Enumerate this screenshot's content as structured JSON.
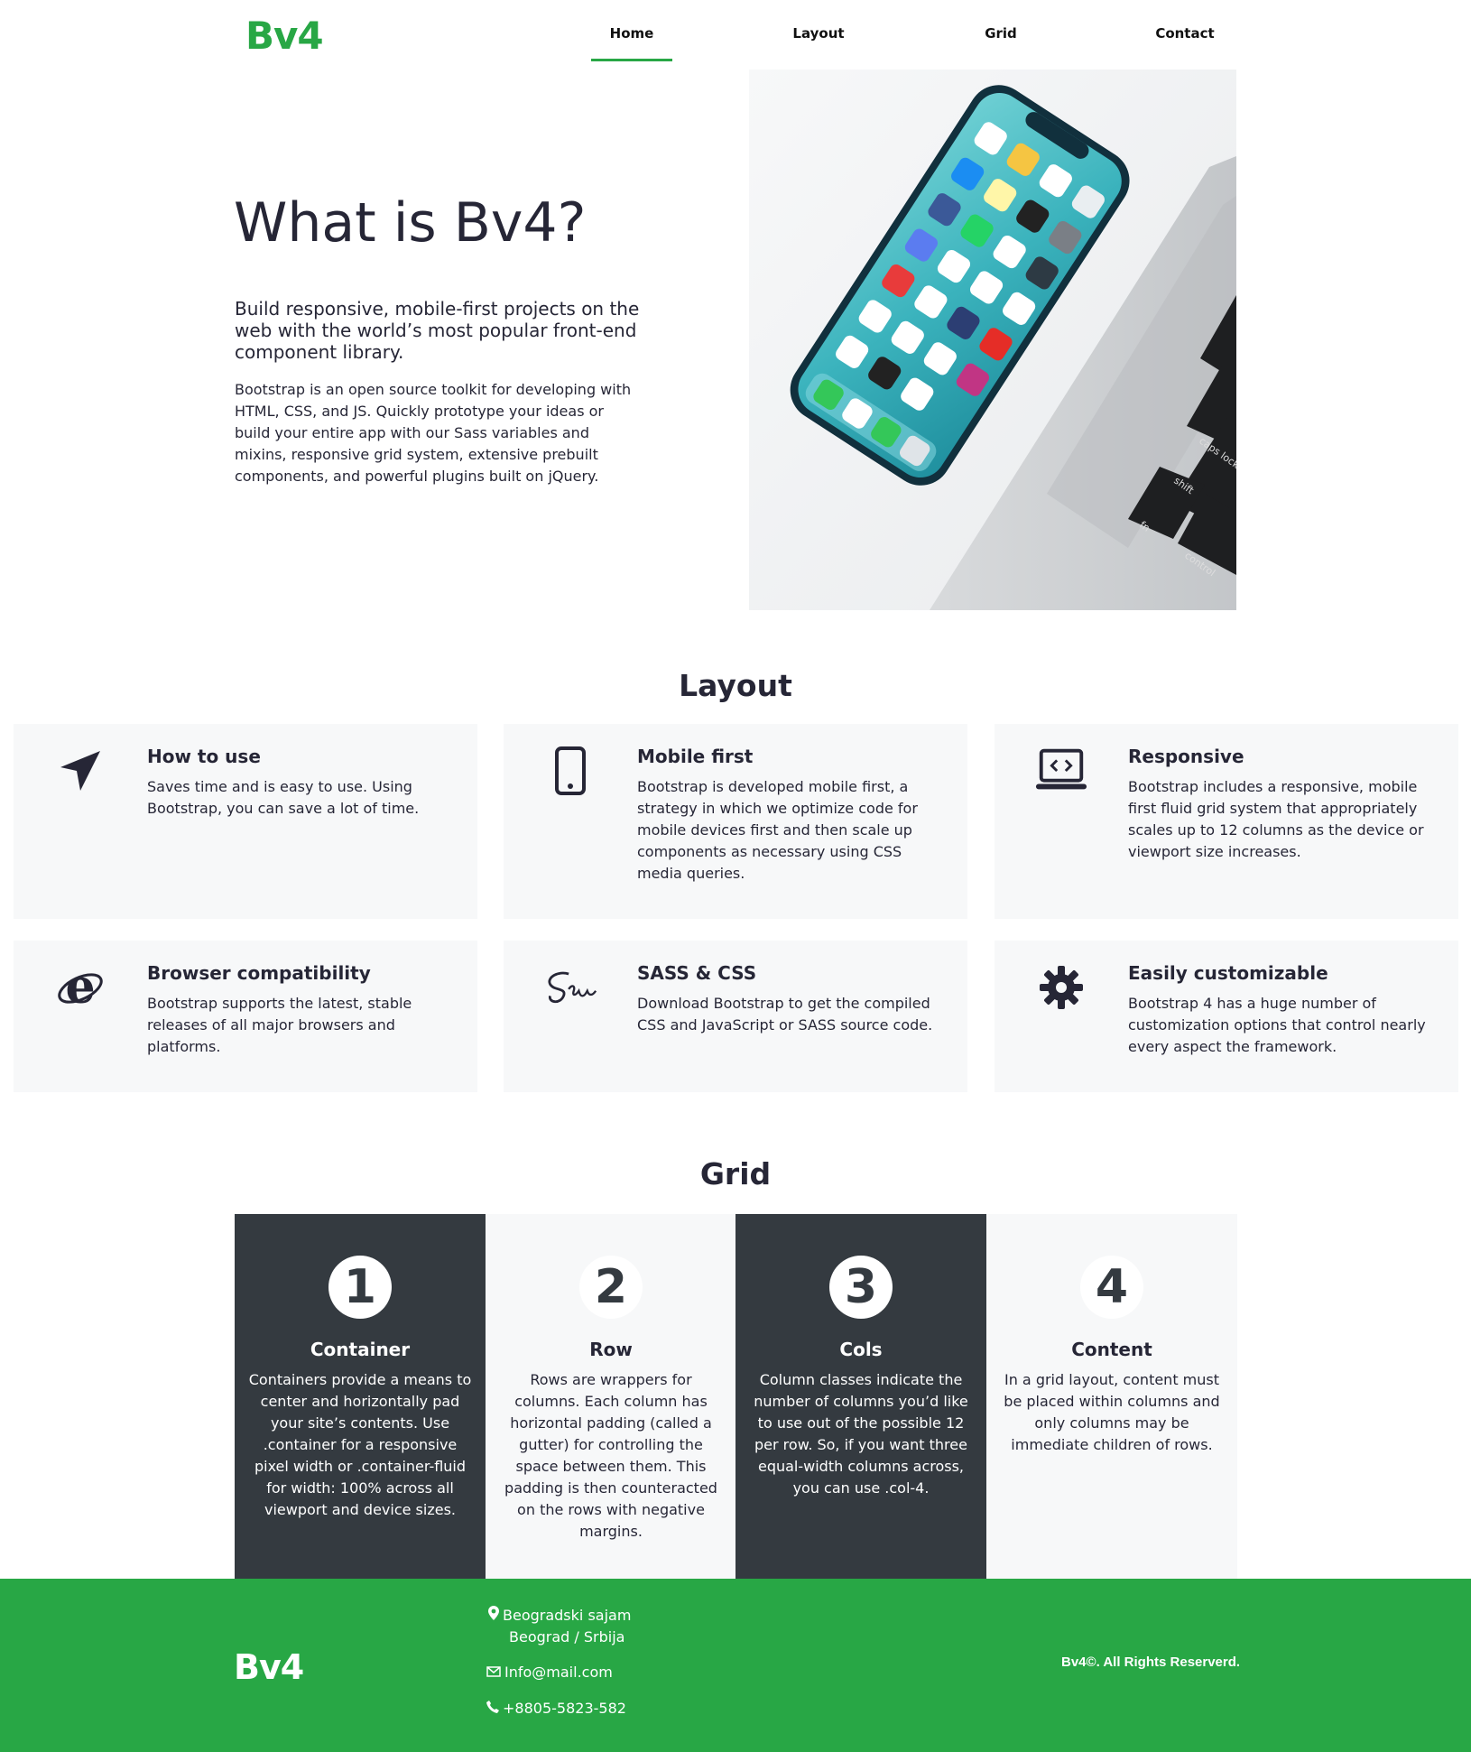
{
  "nav": {
    "brand": "Bv4",
    "links": [
      "Home",
      "Layout",
      "Grid",
      "Contact"
    ],
    "active": "Home"
  },
  "hero": {
    "title": "What is Bv4?",
    "lead": "Build responsive, mobile-first projects on the web with the world’s most popular front-end component library.",
    "text": "Bootstrap is an open source toolkit for developing with HTML, CSS, and JS. Quickly prototype your ideas or build your entire app with our Sass variables and mixins, responsive grid system, extensive prebuilt components, and powerful plugins built on jQuery.",
    "image_labels": [
      "caps lock",
      "shift",
      "fn",
      "control"
    ]
  },
  "layout": {
    "title": "Layout",
    "cards": [
      {
        "icon": "paper-plane-icon",
        "title": "How to use",
        "text": "Saves time and is easy to use. Using Bootstrap, you can save a lot of time."
      },
      {
        "icon": "mobile-phone-icon",
        "title": "Mobile first",
        "text": "Bootstrap is developed mobile first, a strategy in which we optimize code for mobile devices first and then scale up components as necessary using CSS media queries."
      },
      {
        "icon": "laptop-code-icon",
        "title": "Responsive",
        "text": "Bootstrap includes a responsive, mobile first fluid grid system that appropriately scales up to 12 columns as the device or viewport size increases."
      },
      {
        "icon": "internet-explorer-icon",
        "title": "Browser compatibility",
        "text": "Bootstrap supports the latest, stable releases of all major browsers and platforms."
      },
      {
        "icon": "sass-icon",
        "title": "SASS & CSS",
        "text": "Download Bootstrap to get the compiled CSS and JavaScript or SASS source code."
      },
      {
        "icon": "gear-icon",
        "title": "Easily customizable",
        "text": "Bootstrap 4 has a huge number of customization options that control nearly every aspect the framework."
      }
    ]
  },
  "grid": {
    "title": "Grid",
    "columns": [
      {
        "number": "1",
        "title": "Container",
        "text": "Containers provide a means to center and horizontally pad your site’s contents. Use .container for a responsive pixel width or .container-fluid for width: 100% across all viewport and device sizes."
      },
      {
        "number": "2",
        "title": "Row",
        "text": "Rows are wrappers for columns. Each column has horizontal padding (called a gutter) for controlling the space between them. This padding is then counteracted on the rows with negative margins."
      },
      {
        "number": "3",
        "title": "Cols",
        "text": "Column classes indicate the number of columns you’d like to use out of the possible 12 per row. So, if you want three equal-width columns across, you can use .col-4."
      },
      {
        "number": "4",
        "title": "Content",
        "text": "In a grid layout, content must be placed within columns and only columns may be immediate children of rows."
      }
    ]
  },
  "footer": {
    "brand": "Bv4",
    "address_line1": "Beogradski sajam",
    "address_line2": "Beograd / Srbija",
    "email": "Info@mail.com",
    "phone": "+8805-5823-582",
    "copyright": "Bv4©. All Rights Reserverd."
  },
  "colors": {
    "brand_green": "#28a745",
    "dark_column": "#343a40",
    "light_card": "#f7f8f9",
    "text": "#262636"
  }
}
